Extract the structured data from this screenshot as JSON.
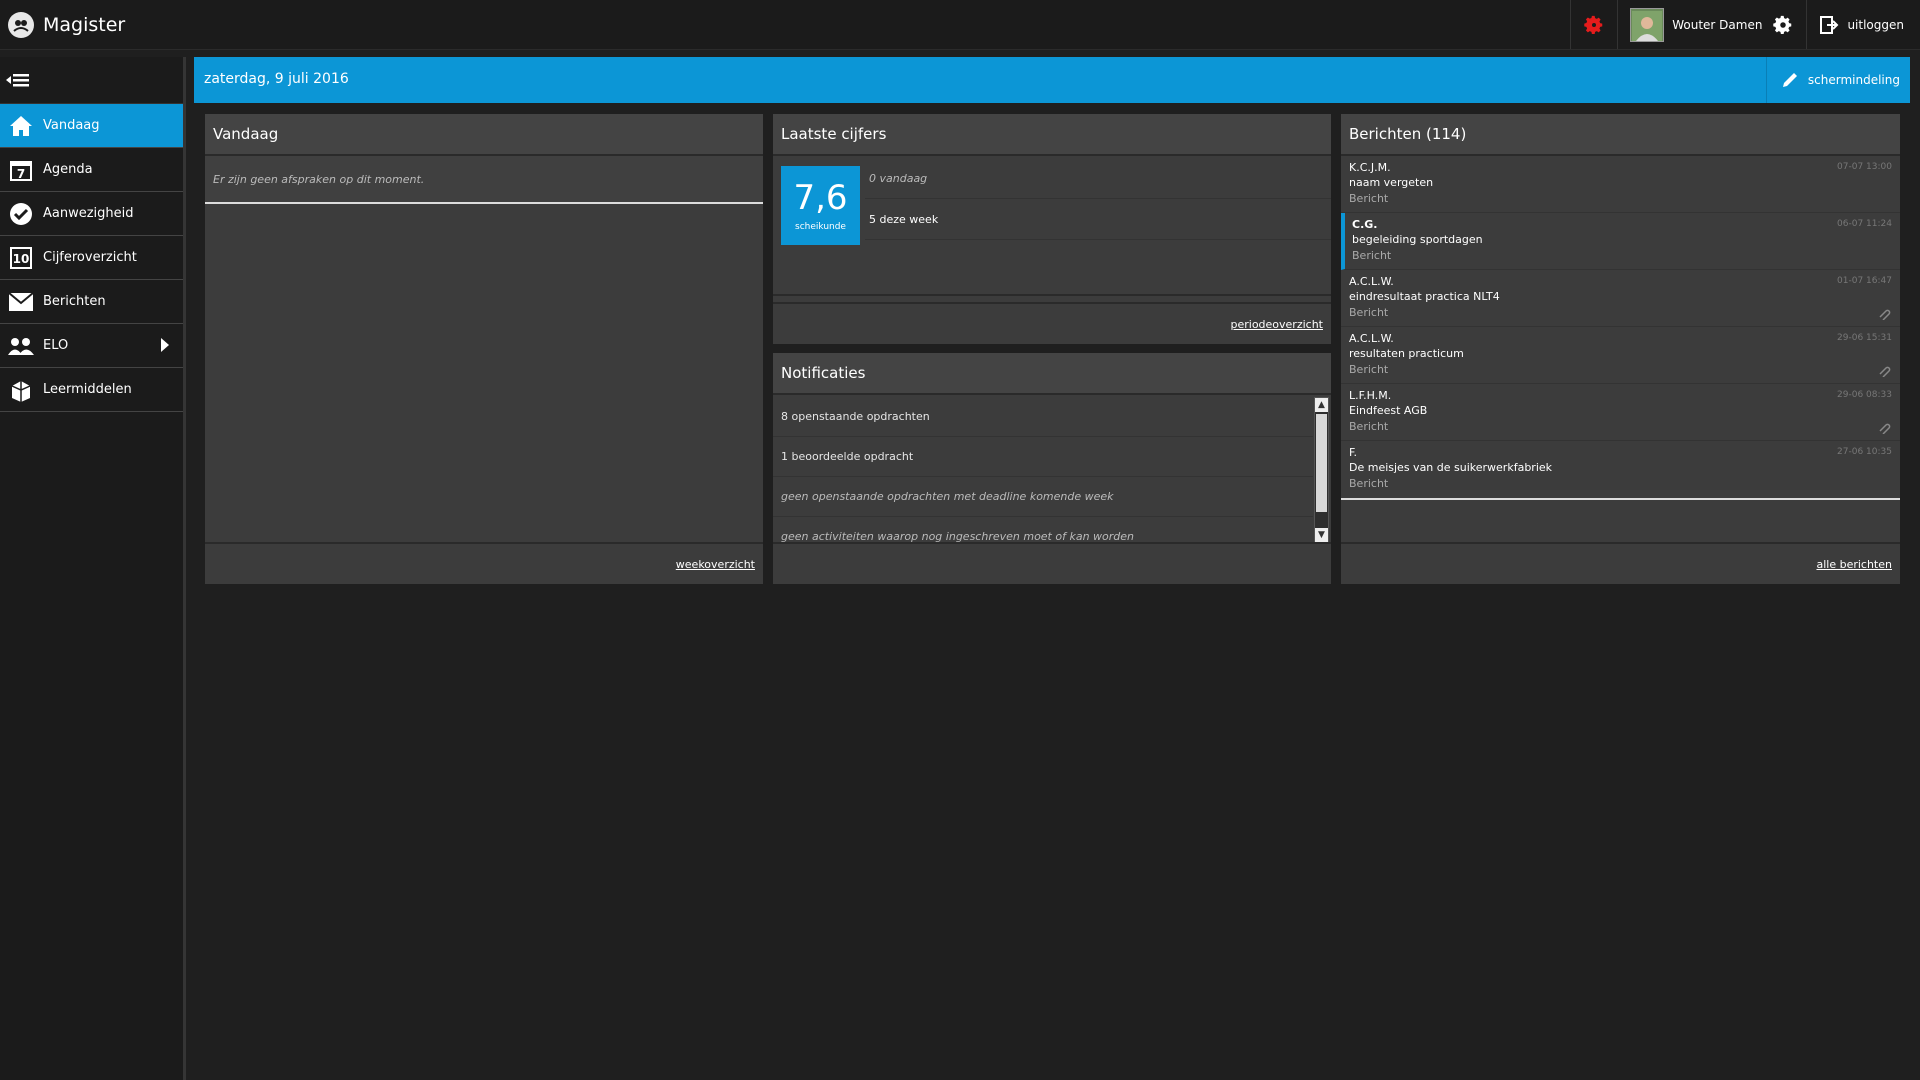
{
  "app": {
    "title": "Magister"
  },
  "topbar": {
    "user_name": "Wouter Damen",
    "logout_label": "uitloggen"
  },
  "sidebar": {
    "items": [
      {
        "label": "Vandaag",
        "icon": "home-icon",
        "active": true
      },
      {
        "label": "Agenda",
        "icon": "calendar-icon"
      },
      {
        "label": "Aanwezigheid",
        "icon": "checkmark-icon"
      },
      {
        "label": "Cijferoverzicht",
        "icon": "grade-icon"
      },
      {
        "label": "Berichten",
        "icon": "envelope-icon"
      },
      {
        "label": "ELO",
        "icon": "users-icon",
        "has_submenu": true
      },
      {
        "label": "Leermiddelen",
        "icon": "books-icon"
      }
    ]
  },
  "header": {
    "date": "zaterdag, 9 juli 2016",
    "layout_label": "schermindeling"
  },
  "vandaag": {
    "title": "Vandaag",
    "empty_text": "Er zijn geen afspraken op dit moment.",
    "footer_link": "weekoverzicht"
  },
  "cijfers": {
    "title": "Laatste cijfers",
    "grade_value": "7,6",
    "grade_subject": "scheikunde",
    "today_count": "0 vandaag",
    "week_count": "5 deze week",
    "footer_link": "periodeoverzicht"
  },
  "notificaties": {
    "title": "Notificaties",
    "items": [
      {
        "text": "8 openstaande opdrachten",
        "muted": false
      },
      {
        "text": "1 beoordeelde opdracht",
        "muted": false
      },
      {
        "text": "geen openstaande opdrachten met deadline komende week",
        "muted": true
      },
      {
        "text": "geen activiteiten waarop nog ingeschreven moet of kan worden",
        "muted": true
      }
    ]
  },
  "berichten": {
    "title": "Berichten (114)",
    "footer_link": "alle berichten",
    "items": [
      {
        "from": "K.C.J.M.",
        "subject": "naam vergeten",
        "type": "Bericht",
        "time": "07-07 13:00",
        "attachment": false,
        "selected": false
      },
      {
        "from": "C.G.",
        "subject": "begeleiding sportdagen",
        "type": "Bericht",
        "time": "06-07 11:24",
        "attachment": false,
        "selected": true
      },
      {
        "from": "A.C.L.W.",
        "subject": "eindresultaat practica NLT4",
        "type": "Bericht",
        "time": "01-07 16:47",
        "attachment": true,
        "selected": false
      },
      {
        "from": "A.C.L.W.",
        "subject": "resultaten practicum",
        "type": "Bericht",
        "time": "29-06 15:31",
        "attachment": true,
        "selected": false
      },
      {
        "from": "L.F.H.M.",
        "subject": "Eindfeest AGB",
        "type": "Bericht",
        "time": "29-06 08:33",
        "attachment": true,
        "selected": false
      },
      {
        "from": "F.",
        "subject": "De meisjes van de suikerwerkfabriek",
        "type": "Bericht",
        "time": "27-06 10:35",
        "attachment": false,
        "selected": false
      }
    ]
  },
  "colors": {
    "accent": "#0c96d6",
    "alert": "#e51c1c"
  }
}
